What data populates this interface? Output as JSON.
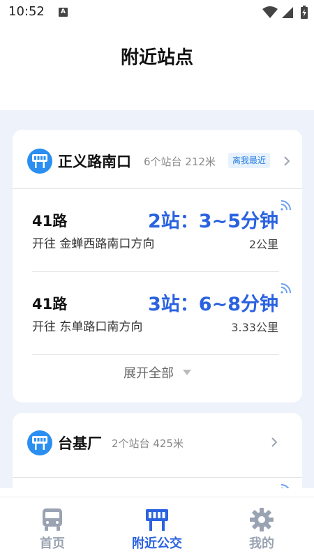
{
  "status_bar": {
    "time": "10:52",
    "notification_letter": "A"
  },
  "header": {
    "title": "附近站点"
  },
  "stops": [
    {
      "name": "正义路南口",
      "meta": "6个站台 212米",
      "badge": "离我最近",
      "routes": [
        {
          "name": "41路",
          "direction": "开往 金蝉西路南口方向",
          "eta": "2站：3~5分钟",
          "distance": "2公里"
        },
        {
          "name": "41路",
          "direction": "开往 东单路口南方向",
          "eta": "3站：6~8分钟",
          "distance": "3.33公里"
        }
      ],
      "expand_label": "展开全部"
    },
    {
      "name": "台基厂",
      "meta": "2个站台 425米"
    }
  ],
  "nav": {
    "items": [
      {
        "label": "首页",
        "icon": "bus-icon",
        "active": false
      },
      {
        "label": "附近公交",
        "icon": "bus-stop-icon",
        "active": true
      },
      {
        "label": "我的",
        "icon": "gear-icon",
        "active": false
      }
    ]
  },
  "colors": {
    "accent": "#2a62e0",
    "stop_icon": "#2a8ff0",
    "background": "#eef2fa",
    "nav_inactive": "#9aa3b2"
  }
}
